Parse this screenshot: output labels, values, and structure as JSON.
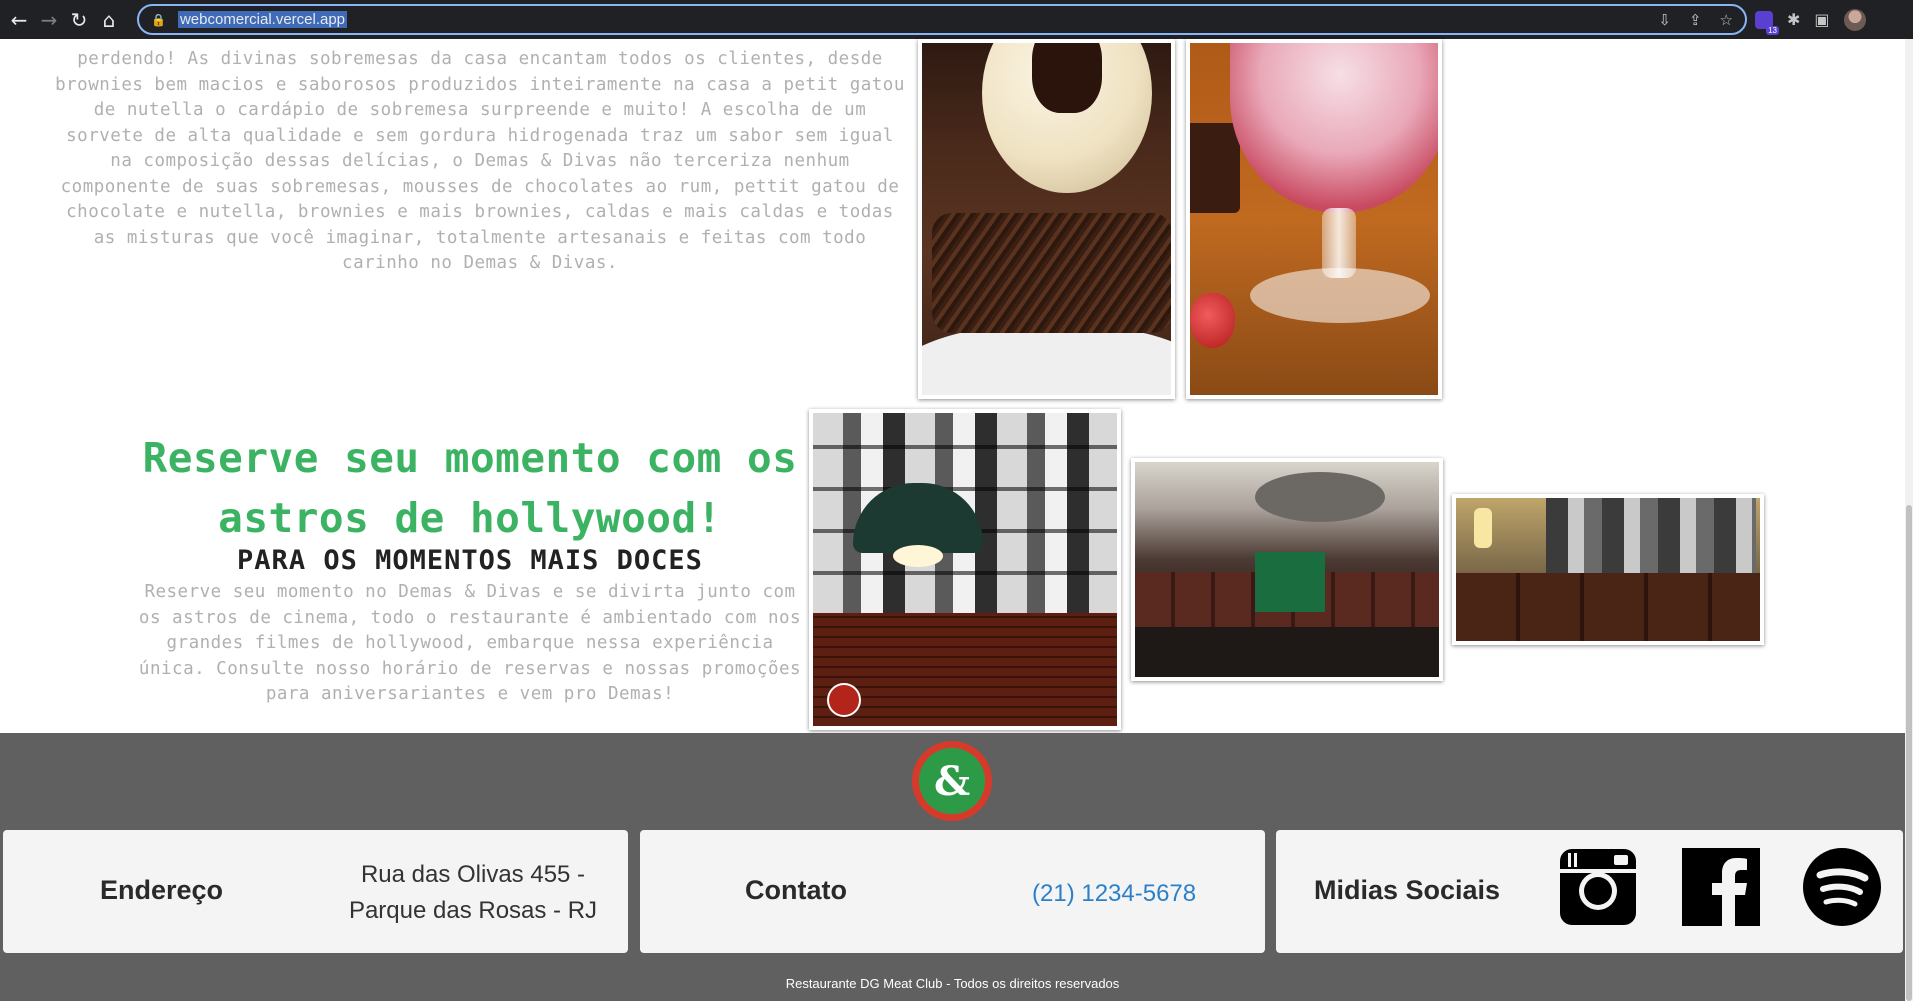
{
  "browser": {
    "url": "webcomercial.vercel.app",
    "extension_badge": "13"
  },
  "sections": {
    "desserts_paragraph": "perdendo! As divinas sobremesas da casa encantam todos os clientes, desde brownies bem macios e saborosos produzidos inteiramente na casa a petit gatou de nutella o cardápio de sobremesa surpreende e muito! A escolha de um sorvete de alta qualidade e sem gordura hidrogenada traz um sabor sem igual na composição dessas delícias, o Demas & Divas não terceriza nenhum componente de suas sobremesas, mousses de chocolates ao rum, pettit gatou de chocolate e nutella, brownies e mais brownies, caldas e mais caldas e todas as misturas que você imaginar, totalmente artesanais e feitas com todo carinho no Demas & Divas.",
    "reserve_heading": "Reserve seu momento com os astros de hollywood!",
    "reserve_subheading": "PARA OS MOMENTOS MAIS DOCES",
    "reserve_paragraph": "Reserve seu momento no Demas & Divas e se divirta junto com os astros de cinema, todo o restaurante é ambientado com nos grandes filmes de hollywood, embarque nessa experiência única. Consulte nosso horário de reservas e nossas promoções para aniversariantes e vem pro Demas!"
  },
  "footer": {
    "address_title": "Endereço",
    "address_text": "Rua das Olivas 455 - Parque das Rosas - RJ",
    "contact_title": "Contato",
    "contact_phone": "(21) 1234-5678",
    "social_title": "Midias Sociais",
    "social_icons": [
      "instagram-icon",
      "facebook-icon",
      "spotify-icon"
    ],
    "copyright": "Restaurante DG Meat Club - Todos os direitos reservados"
  },
  "colors": {
    "heading_green": "#3cb363",
    "footer_bg": "#606060",
    "phone_link": "#2b80c9"
  }
}
